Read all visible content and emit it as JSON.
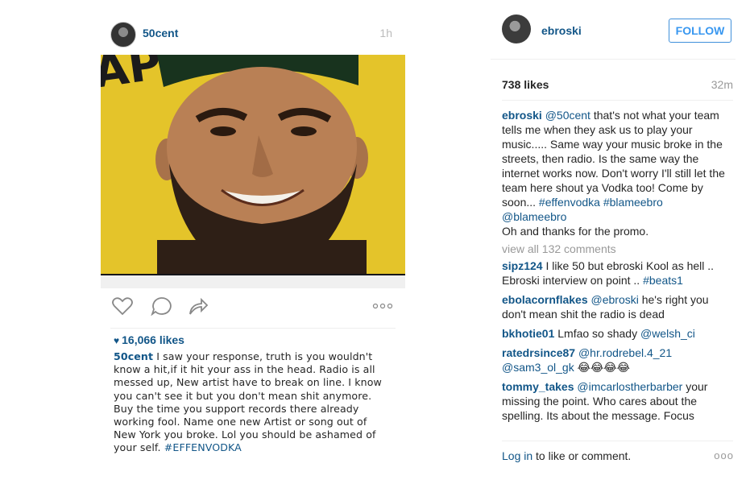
{
  "embedded_post": {
    "username": "50cent",
    "time": "1h",
    "likes": "16,066 likes",
    "caption_user": "50cent",
    "caption_text": " I saw your response, truth is you wouldn't know a hit,if it hit your ass in the head. Radio is all messed up, New artist have to break on line. I know you can't see it but you don't mean shit anymore. Buy the time you support records there already working fool. Name one new Artist or song out of New York you broke. Lol you should be ashamed of your self. ",
    "caption_hashtag": "#EFFENVODKA",
    "icons": [
      "heart-icon",
      "comment-icon",
      "share-icon",
      "more-options-icon"
    ]
  },
  "post": {
    "username": "ebroski",
    "follow_label": "FOLLOW",
    "likes": "738 likes",
    "time": "32m",
    "caption": {
      "user": "ebroski",
      "mention": "@50cent",
      "text1": " that's not what your team tells me when they ask us to play your music..... Same way your music broke in the streets, then radio. Is the same way the internet works now. Don't worry I'll still let the team here shout ya Vodka too! Come by soon... ",
      "tag1": "#effenvodka",
      "tag2": "#blameebro",
      "mention2": "@blameebro",
      "text2": "Oh and thanks for the promo."
    },
    "view_all": "view all 132 comments",
    "comments": [
      {
        "user": "sipz124",
        "text": " I like 50 but ebroski Kool as hell .. Ebroski interview on point .. ",
        "tag": "#beats1"
      },
      {
        "user": "ebolacornflakes",
        "mention": "@ebroski",
        "text": " he's right you don't mean shit the radio is dead"
      },
      {
        "user": "bkhotie01",
        "text": " Lmfao so shady ",
        "mention": "@welsh_ci"
      },
      {
        "user": "ratedrsince87",
        "mention": "@hr.rodrebel.4_21",
        "mention2": "@sam3_ol_gk",
        "text": " 😂😂😂😂"
      },
      {
        "user": "tommy_takes",
        "mention": "@imcarlostherbarber",
        "text": " your missing the point. Who cares about the spelling. Its about the message. Focus"
      }
    ],
    "login_link": "Log in",
    "login_text": " to like or comment.",
    "more_dots": "ooo"
  }
}
